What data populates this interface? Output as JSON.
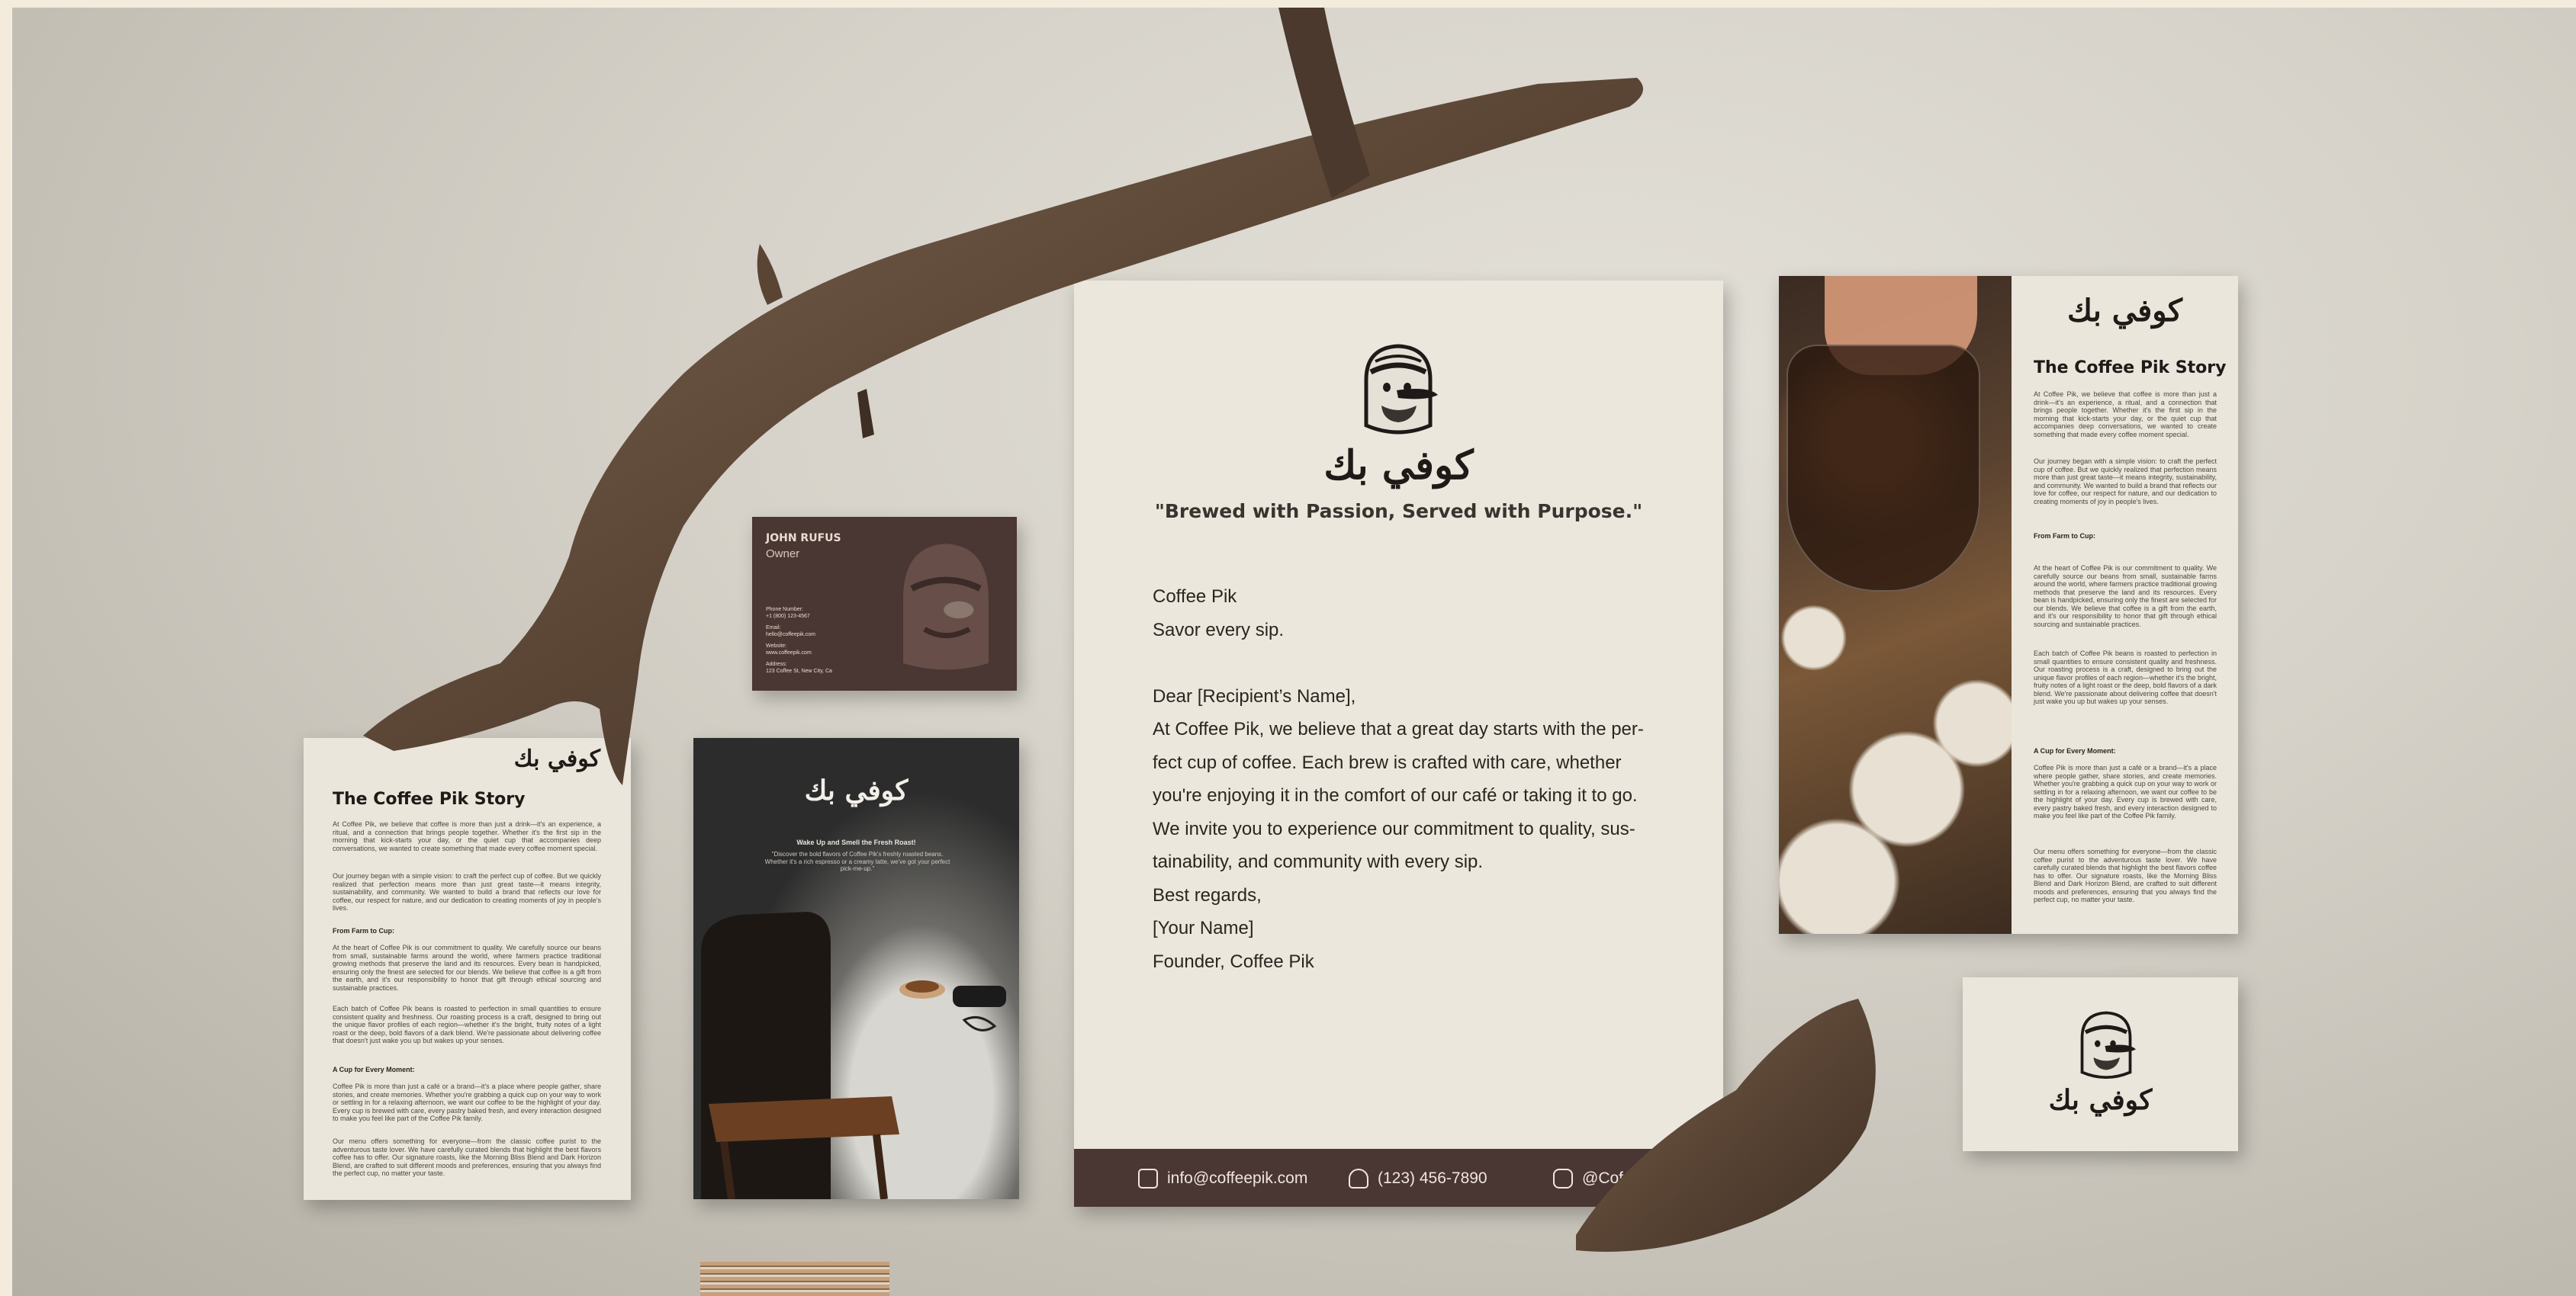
{
  "letterhead": {
    "logo_text": "كوفي بك",
    "tagline": "\"Brewed with Passion, Served with Purpose.\"",
    "lines": [
      "Coffee Pik",
      "Savor every sip.",
      "",
      "Dear [Recipient’s Name],",
      "At Coffee Pik, we believe that a great day starts with the per-",
      "fect cup of coffee. Each brew is crafted with care, whether",
      "you're enjoying it in the comfort of our café or taking it to go.",
      "We invite you to experience our commitment to quality, sus-",
      "tainability, and community with every sip.",
      "Best regards,",
      "[Your Name]",
      "Founder, Coffee Pik"
    ],
    "footer": {
      "email": "info@coffeepik.com",
      "phone": "(123) 456-7890",
      "social": "@Cof"
    },
    "icons": [
      "envelope-icon",
      "phone-icon",
      "instagram-icon"
    ]
  },
  "business_card": {
    "name": "JOHN RUFUS",
    "role": "Owner",
    "phone_label": "Phone Number:",
    "phone": "+1 (800) 123-4567",
    "email_label": "Email:",
    "email": "hello@coffeepik.com",
    "website_label": "Website:",
    "website": "www.coffeepik.com",
    "address_label": "Address:",
    "address": "123 Coffee St, New City, Ca"
  },
  "brochure": {
    "logo_text": "كوفي بك",
    "title": "The Coffee Pik Story",
    "intro": "At Coffee Pik, we believe that coffee is more than just a drink—it's an experience, a ritual, and a connection that brings people together. Whether it's the first sip in the morning that kick-starts your day, or the quiet cup that accompanies deep conversations, we wanted to create something that made every coffee moment special.",
    "journey": "Our journey began with a simple vision: to craft the perfect cup of coffee. But we quickly realized that perfection means more than just great taste—it means integrity, sustainability, and community. We wanted to build a brand that reflects our love for coffee, our respect for nature, and our dedication to creating moments of joy in people's lives.",
    "h_farm": "From Farm to Cup:",
    "farm": "At the heart of Coffee Pik is our commitment to quality. We carefully source our beans from small, sustainable farms around the world, where farmers practice traditional growing methods that preserve the land and its resources. Every bean is handpicked, ensuring only the finest are selected for our blends. We believe that coffee is a gift from the earth, and it's our responsibility to honor that gift through ethical sourcing and sustainable practices.",
    "roast": "Each batch of Coffee Pik beans is roasted to perfection in small quantities to ensure consistent quality and freshness. Our roasting process is a craft, designed to bring out the unique flavor profiles of each region—whether it's the bright, fruity notes of a light roast or the deep, bold flavors of a dark blend. We're passionate about delivering coffee that doesn't just wake you up but wakes up your senses.",
    "h_everyone": "A Cup for Every Moment:",
    "everyone": "Coffee Pik is more than just a café or a brand—it's a place where people gather, share stories, and create memories. Whether you're grabbing a quick cup on your way to work or settling in for a relaxing afternoon, we want our coffee to be the highlight of your day. Every cup is brewed with care, every pastry baked fresh, and every interaction designed to make you feel like part of the Coffee Pik family.",
    "menu": "Our menu offers something for everyone—from the classic coffee purist to the adventurous taste lover. We have carefully curated blends that highlight the best flavors coffee has to offer. Our signature roasts, like the Morning Bliss Blend and Dark Horizon Blend, are crafted to suit different moods and preferences, ensuring that you always find the perfect cup, no matter your taste."
  },
  "flyer": {
    "logo_text": "كوفي بك",
    "title": "The Coffee Pik Story"
  },
  "poster": {
    "logo_text": "كوفي بك",
    "headline": "Wake Up and Smell the Fresh Roast!",
    "sub": "\"Discover the bold flavors of Coffee Pik's freshly roasted beans. Whether it's a rich espresso or a creamy latte, we've got your perfect pick-me-up.\""
  },
  "small_card": {
    "logo_text": "كوفي بك"
  },
  "colors": {
    "brand_brown": "#4a3632",
    "paper_cream": "#ebe6db",
    "wall": "#d6d2c9"
  }
}
